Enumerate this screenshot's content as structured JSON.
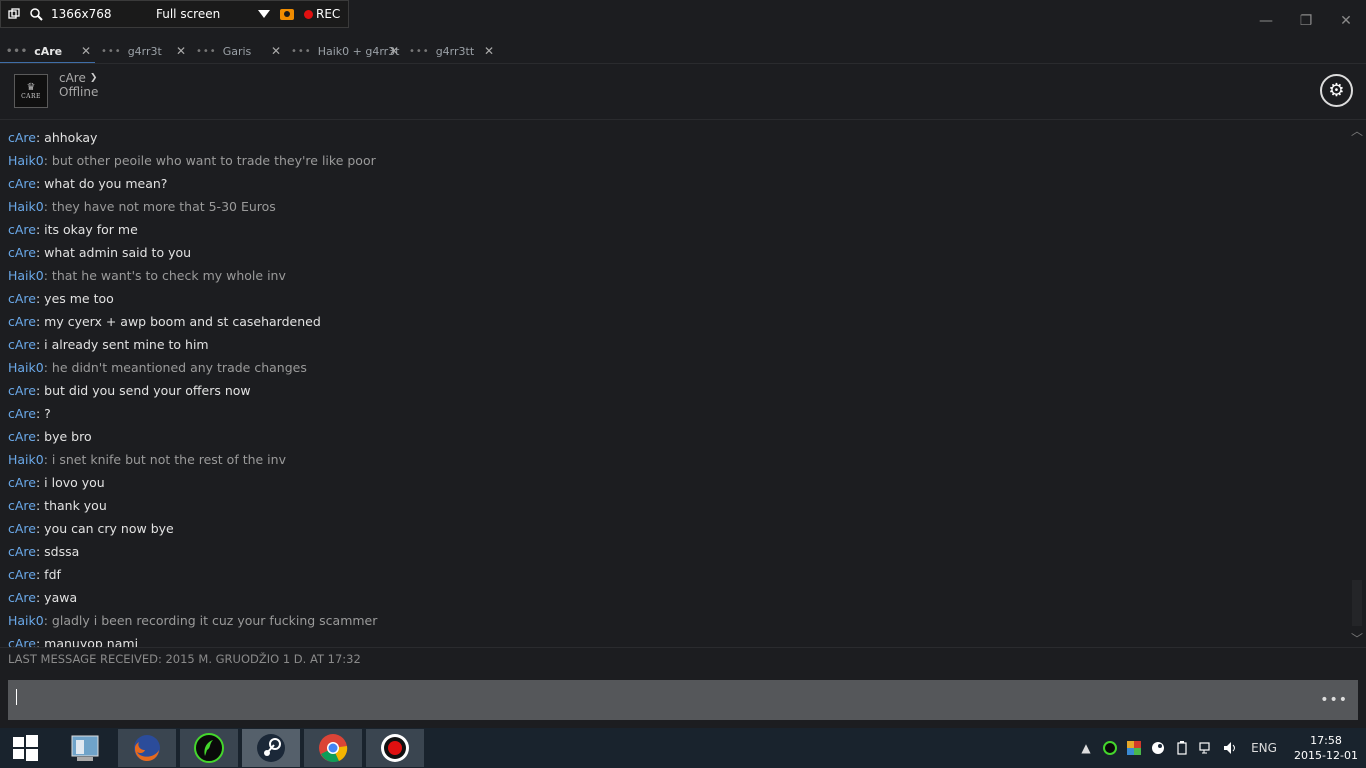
{
  "recorder": {
    "resolution": "1366x768",
    "mode": "Full screen",
    "rec_label": "REC"
  },
  "window_controls": {
    "minimize": "—",
    "restore": "❐",
    "close": "✕"
  },
  "tabs": [
    {
      "label": "cAre",
      "active": true
    },
    {
      "label": "g4rr3t",
      "active": false
    },
    {
      "label": "Garis",
      "active": false
    },
    {
      "label": "Haik0 + g4rr3t",
      "active": false
    },
    {
      "label": "g4rr3tt",
      "active": false
    }
  ],
  "header": {
    "avatar_text": "CARE",
    "username": "cAre",
    "status": "Offline"
  },
  "messages": [
    {
      "nick": "cAre",
      "sep": ": ",
      "text": "ahhokay",
      "self": true
    },
    {
      "nick": "Haik0",
      "sep": ": ",
      "text": "but other peoile who want to trade they're like poor",
      "self": false
    },
    {
      "nick": "cAre",
      "sep": ": ",
      "text": "what do you mean?",
      "self": true
    },
    {
      "nick": "Haik0",
      "sep": ": ",
      "text": "they have not more that 5-30 Euros",
      "self": false
    },
    {
      "nick": "cAre",
      "sep": ": ",
      "text": "its okay for me",
      "self": true
    },
    {
      "nick": "cAre",
      "sep": ": ",
      "text": "what admin said to you",
      "self": true
    },
    {
      "nick": "Haik0",
      "sep": ": ",
      "text": "that he want's to check my whole inv",
      "self": false
    },
    {
      "nick": "cAre",
      "sep": ": ",
      "text": "yes me too",
      "self": true
    },
    {
      "nick": "cAre",
      "sep": ": ",
      "text": "my cyerx + awp boom and st casehardened",
      "self": true
    },
    {
      "nick": "cAre",
      "sep": ": ",
      "text": "i already sent mine to him",
      "self": true
    },
    {
      "nick": "Haik0",
      "sep": ": ",
      "text": "he didn't meantioned any trade changes",
      "self": false
    },
    {
      "nick": "cAre",
      "sep": ": ",
      "text": "but did you send your offers now",
      "self": true
    },
    {
      "nick": "cAre",
      "sep": ": ",
      "text": "?",
      "self": true
    },
    {
      "nick": "cAre",
      "sep": ": ",
      "text": "bye bro",
      "self": true
    },
    {
      "nick": "Haik0",
      "sep": ": ",
      "text": "i snet knife but not the rest of the inv",
      "self": false
    },
    {
      "nick": "cAre",
      "sep": ": ",
      "text": "i lovo you",
      "self": true
    },
    {
      "nick": "cAre",
      "sep": ": ",
      "text": "thank you",
      "self": true
    },
    {
      "nick": "cAre",
      "sep": ": ",
      "text": "you can cry now bye",
      "self": true
    },
    {
      "nick": "cAre",
      "sep": ": ",
      "text": "sdssa",
      "self": true
    },
    {
      "nick": "cAre",
      "sep": ": ",
      "text": "fdf",
      "self": true
    },
    {
      "nick": "cAre",
      "sep": ": ",
      "text": "yawa",
      "self": true
    },
    {
      "nick": "Haik0",
      "sep": ": ",
      "text": "gladly i been recording it cuz your fucking scammer",
      "self": false
    },
    {
      "nick": "cAre",
      "sep": ": ",
      "text": "manuyop nami",
      "self": true
    }
  ],
  "last_message": "LAST MESSAGE RECEIVED: 2015 M. GRUODŽIO 1 D. AT 17:32",
  "input": {
    "value": "",
    "more": "•••"
  },
  "taskbar": {
    "items": [
      "windows-start",
      "file-manager",
      "firefox",
      "razer",
      "steam",
      "chrome",
      "recorder"
    ],
    "language": "ENG",
    "time": "17:58",
    "date": "2015-12-01"
  }
}
